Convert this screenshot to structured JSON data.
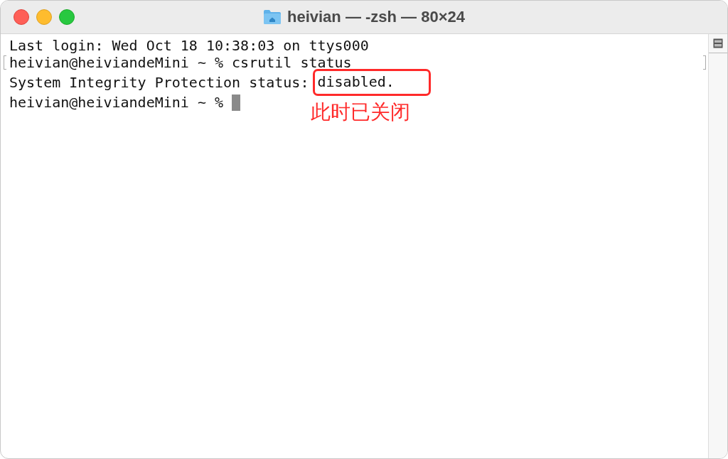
{
  "window": {
    "title": "heivian — -zsh — 80×24"
  },
  "terminal": {
    "lines": [
      {
        "text": "Last login: Wed Oct 18 10:38:03 on ttys000",
        "marked": false,
        "cursor": false
      },
      {
        "text": "heivian@heiviandeMini ~ % csrutil status",
        "marked": true,
        "cursor": false
      },
      {
        "text": "System Integrity Protection status: ",
        "highlight": "disabled.",
        "note": "此时已关闭",
        "marked": false,
        "cursor": false
      },
      {
        "text": "heivian@heiviandeMini ~ % ",
        "marked": false,
        "cursor": true
      }
    ]
  }
}
